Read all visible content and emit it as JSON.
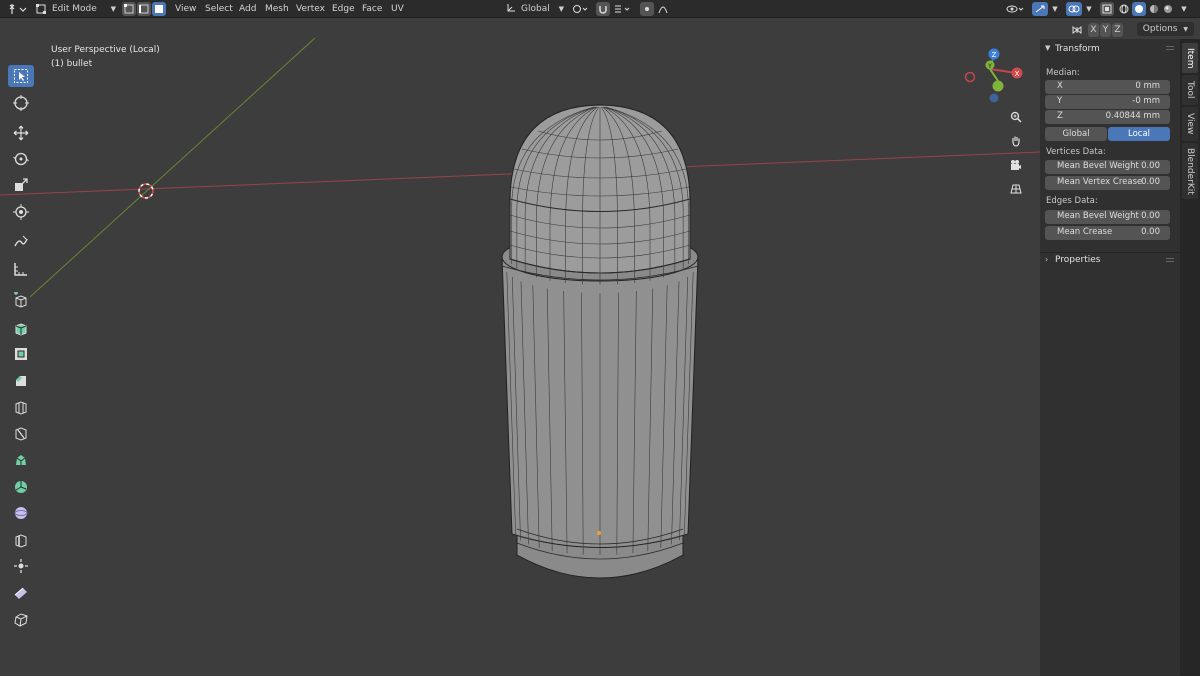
{
  "header": {
    "mode": "Edit Mode",
    "menus": [
      "View",
      "Select",
      "Add",
      "Mesh",
      "Vertex",
      "Edge",
      "Face",
      "UV"
    ],
    "orientation": "Global",
    "axis_buttons": [
      "X",
      "Y",
      "Z"
    ]
  },
  "subheader": {
    "options": "Options"
  },
  "viewport": {
    "perspective": "User Perspective (Local)",
    "object": "(1) bullet"
  },
  "tools": [
    "select-box-icon",
    "cursor-icon",
    "move-icon",
    "rotate-icon",
    "scale-icon",
    "transform-icon",
    "annotate-icon",
    "measure-icon",
    "add-cube-icon",
    "extrude-icon",
    "inset-icon",
    "bevel-icon",
    "loop-cut-icon",
    "knife-icon",
    "poly-build-icon",
    "spin-icon",
    "smooth-icon",
    "edge-slide-icon",
    "shrink-fatten-icon",
    "shear-icon",
    "rip-icon"
  ],
  "npanel": {
    "transform": {
      "title": "Transform",
      "median_label": "Median:",
      "fields": [
        {
          "label": "X",
          "value": "0 mm"
        },
        {
          "label": "Y",
          "value": "-0 mm"
        },
        {
          "label": "Z",
          "value": "0.40844 mm"
        }
      ],
      "space": [
        "Global",
        "Local"
      ],
      "space_selected": "Local",
      "vertices_label": "Vertices Data:",
      "vertices": [
        {
          "label": "Mean Bevel Weight",
          "value": "0.00"
        },
        {
          "label": "Mean Vertex Crease",
          "value": "0.00"
        }
      ],
      "edges_label": "Edges Data:",
      "edges": [
        {
          "label": "Mean Bevel Weight",
          "value": "0.00"
        },
        {
          "label": "Mean Crease",
          "value": "0.00"
        }
      ]
    },
    "properties": {
      "title": "Properties"
    },
    "tabs": [
      "Item",
      "Tool",
      "View",
      "BlenderKit"
    ]
  },
  "colors": {
    "accent": "#4a77b8",
    "x_axis": "#c7454a",
    "y_axis": "#7fb33a",
    "z_axis": "#3d7fd9",
    "mesh_face": "#8f8f8f",
    "wire": "#2a2a2a"
  }
}
